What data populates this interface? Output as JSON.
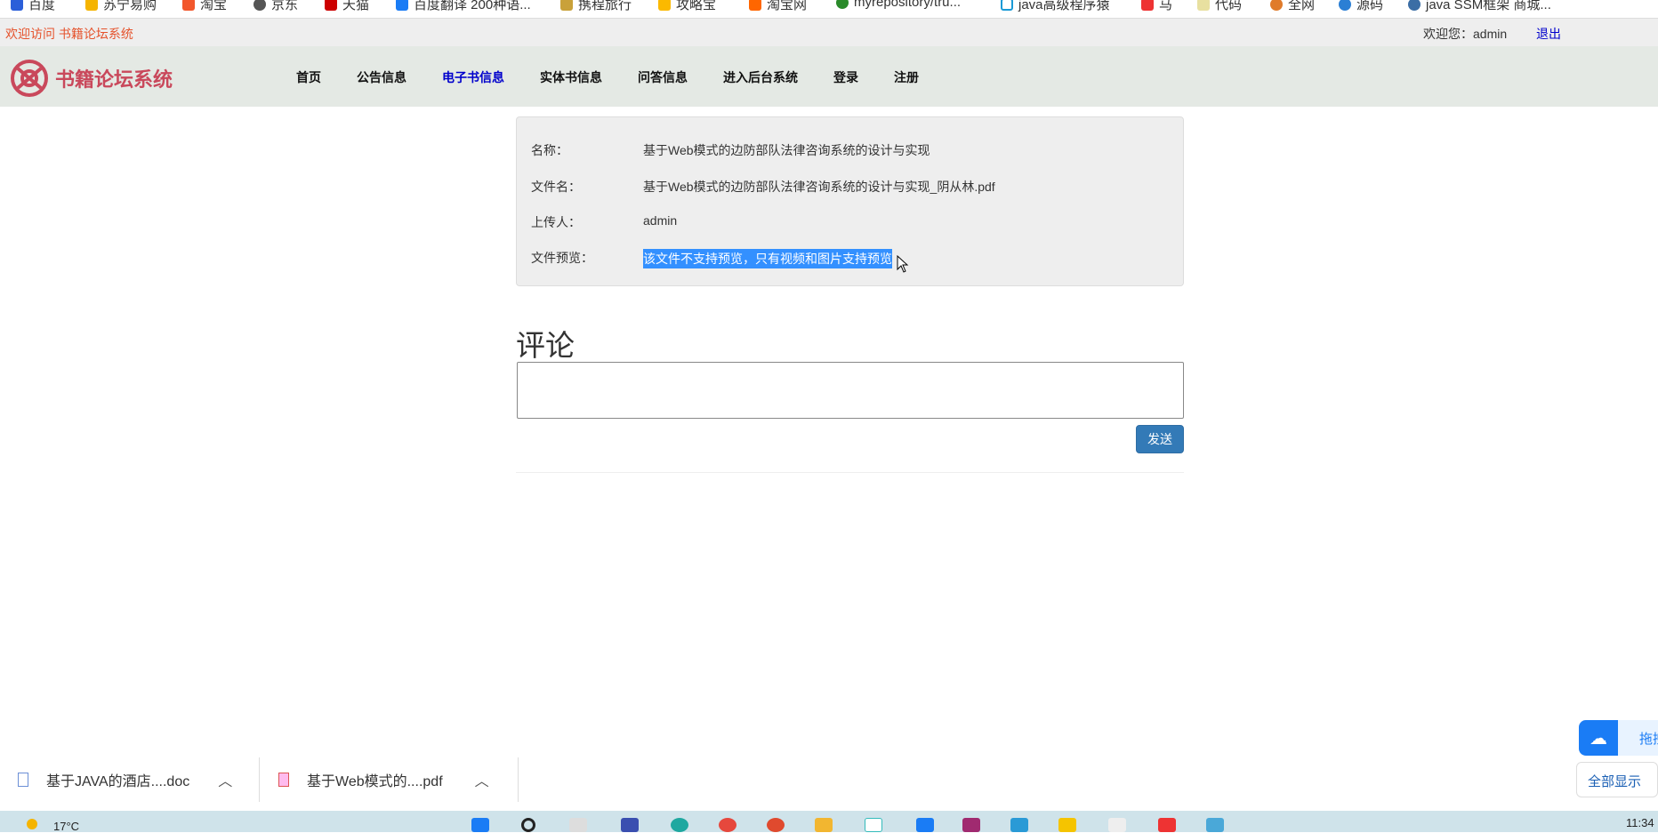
{
  "bookmarks": [
    "百度",
    "苏宁易购",
    "淘宝",
    "京东",
    "天猫",
    "百度翻译 200种语...",
    "携程旅行",
    "攻略宝",
    "淘宝网",
    "myrepository/tru...",
    "java高级程序猿",
    "马",
    "代码",
    "全网",
    "源码",
    "java SSM框架 商城..."
  ],
  "topbar": {
    "welcome": "欢迎访问 书籍论坛系统",
    "user": "欢迎您：admin",
    "logout": "退出"
  },
  "logo": {
    "text": "书籍论坛系统"
  },
  "nav": [
    "首页",
    "公告信息",
    "电子书信息",
    "实体书信息",
    "问答信息",
    "进入后台系统",
    "登录",
    "注册"
  ],
  "detail": {
    "name_label": "名称：",
    "name": "基于Web模式的边防部队法律咨询系统的设计与实现",
    "file_label": "文件名：",
    "file": "基于Web模式的边防部队法律咨询系统的设计与实现_阴从林.pdf",
    "uploader_label": "上传人：",
    "uploader": "admin",
    "preview_label": "文件预览：",
    "preview": "该文件不支持预览，只有视频和图片支持预览"
  },
  "comment": {
    "title": "评论",
    "value": "",
    "send": "发送"
  },
  "downloads": [
    {
      "name": "基于JAVA的酒店....doc"
    },
    {
      "name": "基于Web模式的....pdf"
    }
  ],
  "side": {
    "baidu": "拖拽",
    "show_all": "全部显示"
  },
  "taskbar": {
    "weather": "17°C",
    "time": "11:34"
  },
  "colors": {
    "accent": "#337ab7",
    "active_nav": "#0000cc",
    "logo": "#c9485b",
    "selection": "#3390ff"
  }
}
